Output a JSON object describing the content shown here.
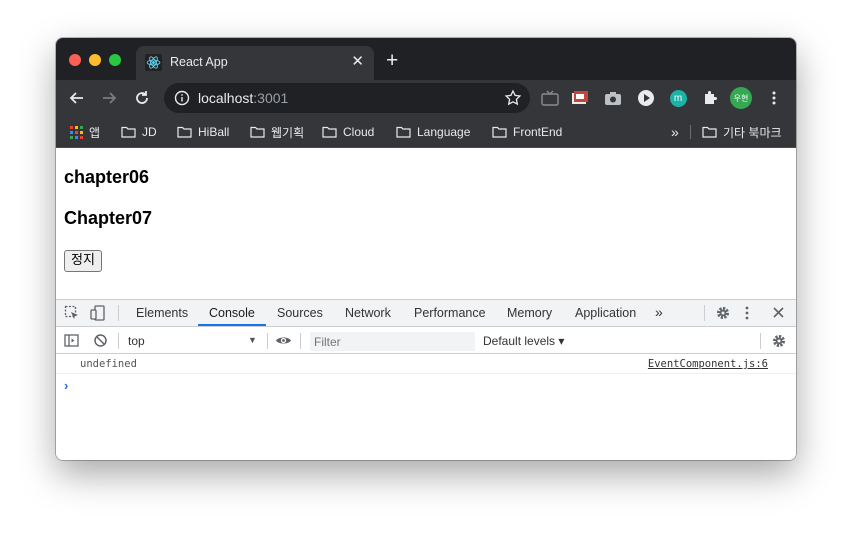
{
  "tab": {
    "title": "React App",
    "close_glyph": "✕",
    "new_tab_glyph": "+",
    "favicon": "react-icon"
  },
  "omnibox": {
    "host": "localhost",
    "port": ":3001"
  },
  "profile": {
    "avatar_text": "우현",
    "extension_badge": "m"
  },
  "bookmarks": {
    "apps": "앱",
    "items": [
      "JD",
      "HiBall",
      "웹기획",
      "Cloud",
      "Language",
      "FrontEnd"
    ],
    "overflow": "»",
    "other": "기타 북마크"
  },
  "page": {
    "heading1": "chapter06",
    "heading2": "Chapter07",
    "button_label": "정지"
  },
  "devtools": {
    "tabs": [
      "Elements",
      "Console",
      "Sources",
      "Network",
      "Performance",
      "Memory",
      "Application"
    ],
    "active_tab": "Console",
    "more_tabs": "»",
    "context": "top",
    "context_arrow": "▼",
    "filter_placeholder": "Filter",
    "levels": "Default levels ▾",
    "log": {
      "message": "undefined",
      "source": "EventComponent.js:6"
    },
    "prompt": "›"
  },
  "colors": {
    "tabstrip": "#202124",
    "toolbar": "#35363a",
    "accent": "#1a73e8",
    "avatar": "#34a853"
  }
}
